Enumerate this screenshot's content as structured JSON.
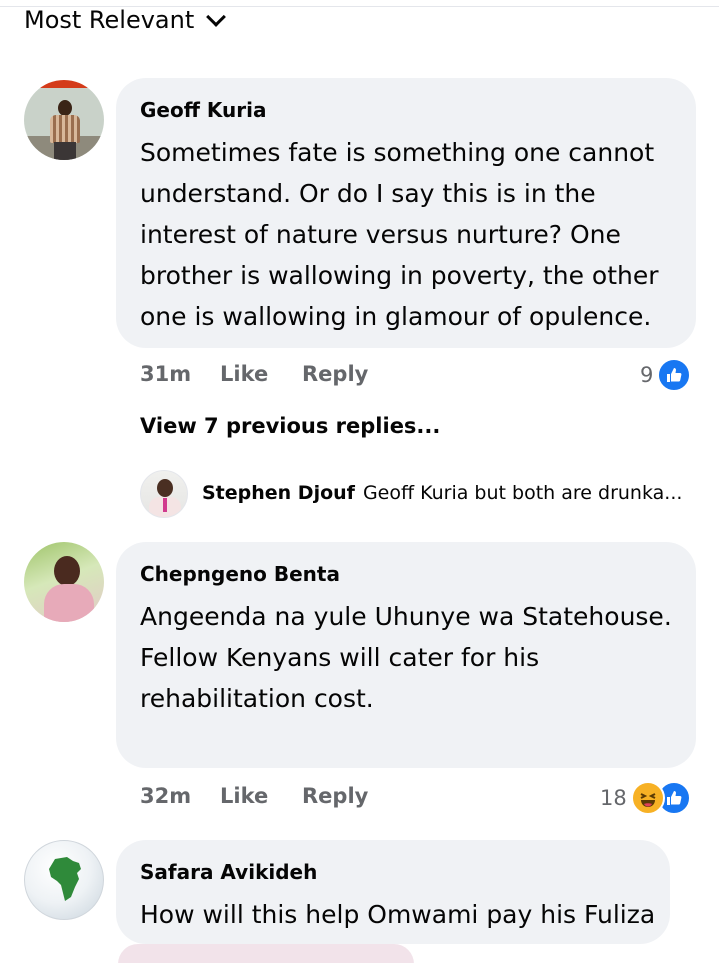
{
  "sort": {
    "label": "Most Relevant"
  },
  "comments": [
    {
      "author": "Geoff Kuria",
      "text": "Sometimes fate is something one cannot understand. Or do I say this is in the interest of nature versus nurture? One brother is wallowing in poverty, the other one is wallowing in glamour of opulence.",
      "time": "31m",
      "like_label": "Like",
      "reply_label": "Reply",
      "reaction_count": "9",
      "reactions": [
        "like-icon"
      ],
      "view_previous": "View 7 previous replies...",
      "latest_reply": {
        "author": "Stephen Djouf",
        "text": "Geoff Kuria but both are drunka..."
      }
    },
    {
      "author": "Chepngeno Benta",
      "text": "Angeenda na yule Uhunye wa Statehouse. Fellow Kenyans will cater for his rehabilitation cost.",
      "time": "32m",
      "like_label": "Like",
      "reply_label": "Reply",
      "reaction_count": "18",
      "reactions": [
        "haha-icon",
        "like-icon"
      ]
    },
    {
      "author": "Safara Avikideh",
      "text": "How will this help Omwami pay his Fuliza"
    }
  ],
  "colors": {
    "bubble": "#f0f2f5",
    "meta_text": "#65676b",
    "like_blue": "#1877f2",
    "haha_yellow": "#f7b125"
  }
}
